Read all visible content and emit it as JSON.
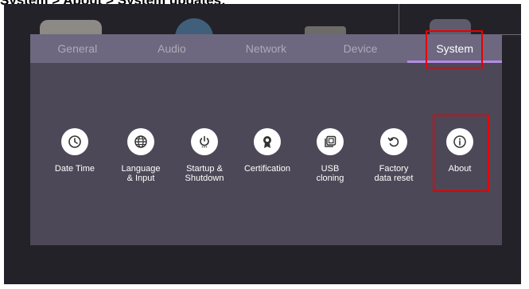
{
  "caption": "System > About > System updates:",
  "tabs": [
    {
      "label": "General",
      "active": false
    },
    {
      "label": "Audio",
      "active": false
    },
    {
      "label": "Network",
      "active": false
    },
    {
      "label": "Device",
      "active": false
    },
    {
      "label": "System",
      "active": true
    }
  ],
  "items": [
    {
      "label": "Date Time",
      "icon": "clock-icon"
    },
    {
      "label": "Language\n& Input",
      "icon": "globe-icon"
    },
    {
      "label": "Startup &\nShutdown",
      "icon": "power-icon"
    },
    {
      "label": "Certification",
      "icon": "award-ribbon-icon"
    },
    {
      "label": "USB\ncloning",
      "icon": "copy-icon"
    },
    {
      "label": "Factory\ndata reset",
      "icon": "reset-icon"
    },
    {
      "label": "About",
      "icon": "info-icon"
    }
  ],
  "colors": {
    "highlight": "#e60000",
    "tab_indicator": "#b48ce6",
    "panel": "#4d4857",
    "tabbar": "#6e6780"
  }
}
